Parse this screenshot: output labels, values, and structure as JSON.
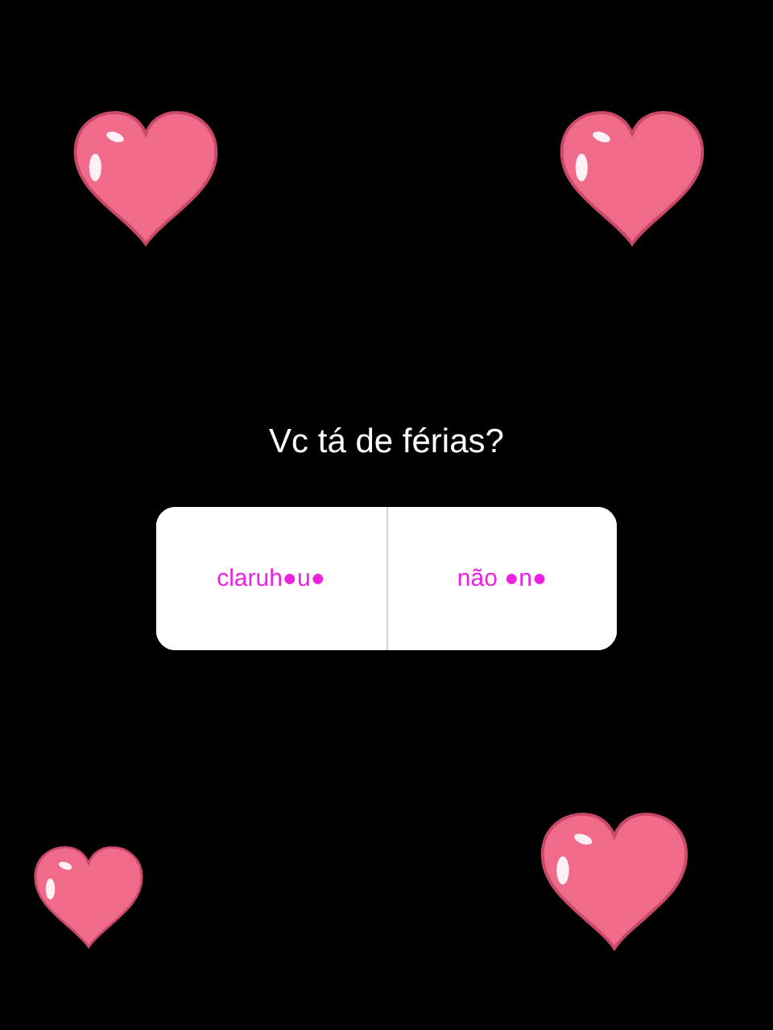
{
  "question": "Vc tá de férias?",
  "options": [
    {
      "label": "claruh●u●"
    },
    {
      "label": "não ●n●"
    }
  ]
}
